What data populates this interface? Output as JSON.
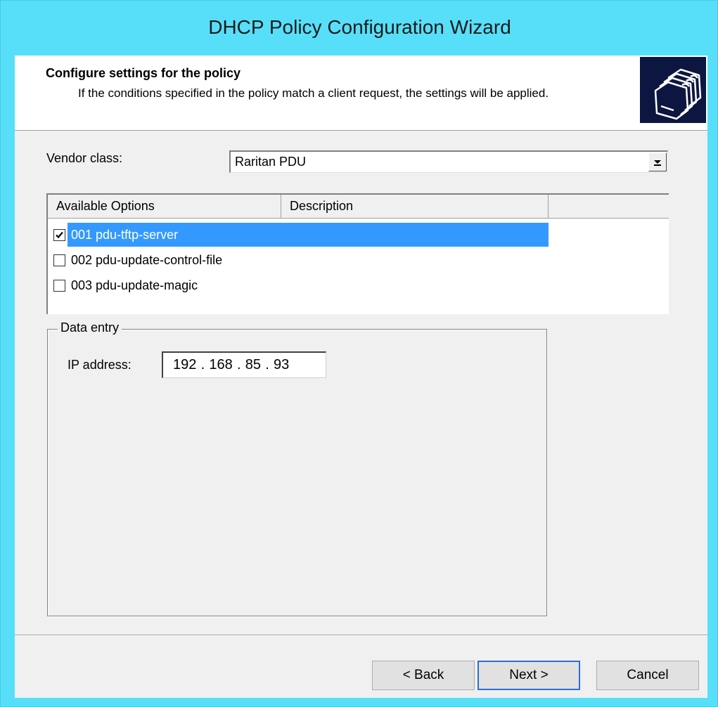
{
  "window": {
    "title": "DHCP Policy Configuration Wizard"
  },
  "header": {
    "title": "Configure settings for the policy",
    "description": "If the conditions specified in the policy match a client request, the settings will be applied.",
    "icon": "folders-icon"
  },
  "vendor_class": {
    "label": "Vendor class:",
    "selected": "Raritan PDU"
  },
  "options_list": {
    "columns": [
      "Available Options",
      "Description"
    ],
    "rows": [
      {
        "label": "001 pdu-tftp-server",
        "checked": true,
        "selected": true
      },
      {
        "label": "002 pdu-update-control-file",
        "checked": false,
        "selected": false
      },
      {
        "label": "003 pdu-update-magic",
        "checked": false,
        "selected": false
      }
    ]
  },
  "data_entry": {
    "legend": "Data entry",
    "ip_label": "IP address:",
    "ip_octets": [
      "192",
      "168",
      "85",
      "93"
    ]
  },
  "buttons": {
    "back": "< Back",
    "next": "Next >",
    "cancel": "Cancel"
  },
  "colors": {
    "title_bar": "#57dff9",
    "selection": "#3399ff",
    "dialog_bg": "#f0f0f0"
  }
}
